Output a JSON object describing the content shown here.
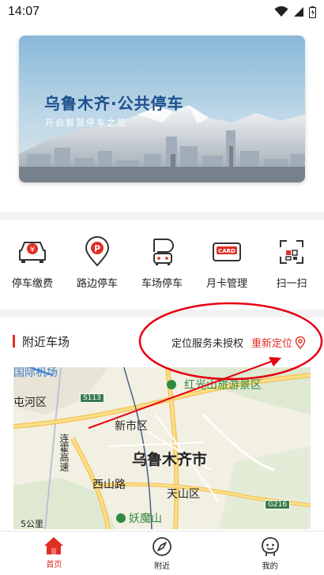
{
  "status_bar": {
    "time": "14:07"
  },
  "banner": {
    "title": "乌鲁木齐·公共停车",
    "subtitle": "开启智慧停车之旅"
  },
  "quick_menu": [
    {
      "label": "停车缴费",
      "icon": "car-yuan-icon"
    },
    {
      "label": "路边停车",
      "icon": "parking-pin-icon"
    },
    {
      "label": "车场停车",
      "icon": "parking-lot-icon"
    },
    {
      "label": "月卡管理",
      "icon": "card-icon"
    },
    {
      "label": "扫一扫",
      "icon": "scan-icon"
    }
  ],
  "nearby": {
    "title": "附近车场",
    "location_status": "定位服务未授权",
    "relocate_label": "重新定位"
  },
  "map": {
    "labels": {
      "airport": "国际机场",
      "tunhe": "屯河区",
      "xinshi": "新市区",
      "city": "乌鲁木齐市",
      "lianhuo": "连霍高速",
      "xishan": "西山路",
      "tianshan": "天山区",
      "hongshan": "红光山旅游景区",
      "yaomo": "妖魔山"
    },
    "shields": {
      "s113": "S113",
      "g216": "G216"
    },
    "scale": "5公里"
  },
  "tabs": [
    {
      "label": "首页",
      "icon": "home-icon",
      "active": true
    },
    {
      "label": "附近",
      "icon": "compass-icon",
      "active": false
    },
    {
      "label": "我的",
      "icon": "profile-icon",
      "active": false
    }
  ],
  "colors": {
    "accent": "#e02e24",
    "banner_title": "#1d4f8c"
  }
}
